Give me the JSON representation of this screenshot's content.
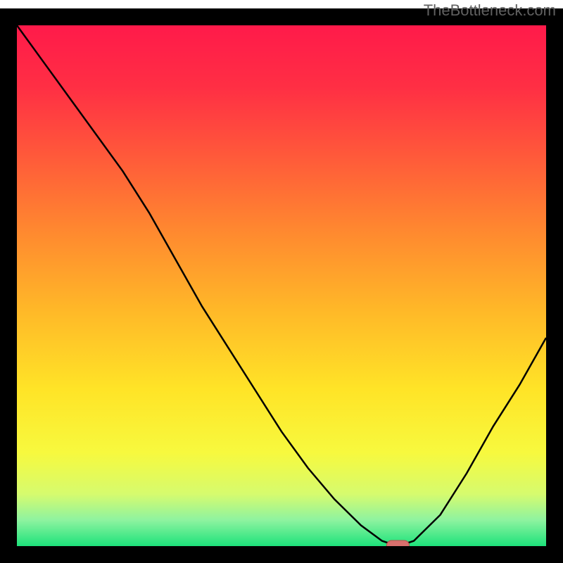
{
  "watermark": "TheBottleneck.com",
  "chart_data": {
    "type": "line",
    "title": "",
    "xlabel": "",
    "ylabel": "",
    "xlim": [
      0,
      100
    ],
    "ylim": [
      0,
      100
    ],
    "x": [
      0,
      5,
      10,
      15,
      20,
      25,
      30,
      35,
      40,
      45,
      50,
      55,
      60,
      65,
      69,
      72,
      75,
      80,
      85,
      90,
      95,
      100
    ],
    "values": [
      100,
      93,
      86,
      79,
      72,
      64,
      55,
      46,
      38,
      30,
      22,
      15,
      9,
      4,
      1,
      0,
      1,
      6,
      14,
      23,
      31,
      40
    ],
    "optimum_x": 72,
    "marker": {
      "x": 72,
      "y": 0
    },
    "gradient_stops": [
      {
        "offset": 0.0,
        "color": "#ff1a4a"
      },
      {
        "offset": 0.12,
        "color": "#ff2f44"
      },
      {
        "offset": 0.25,
        "color": "#ff593a"
      },
      {
        "offset": 0.4,
        "color": "#ff8a2f"
      },
      {
        "offset": 0.55,
        "color": "#ffb928"
      },
      {
        "offset": 0.7,
        "color": "#ffe427"
      },
      {
        "offset": 0.82,
        "color": "#f7f93e"
      },
      {
        "offset": 0.9,
        "color": "#d6fb6e"
      },
      {
        "offset": 0.95,
        "color": "#8ef3a0"
      },
      {
        "offset": 1.0,
        "color": "#1de27b"
      }
    ],
    "border_color": "#000000",
    "curve_color": "#000000",
    "marker_fill": "#d9706d",
    "marker_stroke": "#b94d4a"
  }
}
